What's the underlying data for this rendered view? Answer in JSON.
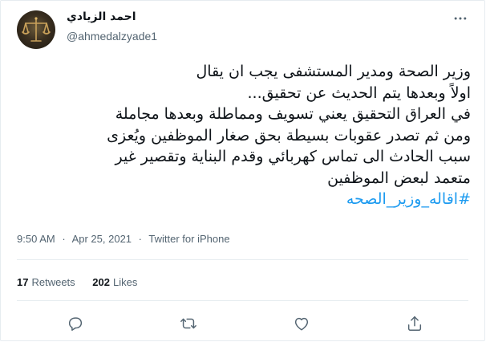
{
  "author": {
    "name": "احمد الزيادي",
    "handle": "@ahmedalzyade1",
    "avatar_icon": "scales-of-justice-icon"
  },
  "tweet": {
    "lines": [
      "وزير الصحة ومدير المستشفى يجب ان يقال",
      "اولاً وبعدها يتم الحديث عن تحقيق...",
      "في العراق التحقيق يعني تسويف ومماطلة وبعدها مجاملة",
      "ومن ثم تصدر عقوبات بسيطة بحق صغار الموظفين ويُعزى",
      "سبب الحادث الى تماس كهربائي وقدم البناية وتقصير غير",
      "متعمد لبعض الموظفين"
    ],
    "hashtag": "#اقاله_وزير_الصحه"
  },
  "meta": {
    "time": "9:50 AM",
    "separator": "·",
    "date": "Apr 25, 2021",
    "source": "Twitter for iPhone"
  },
  "stats": {
    "retweets_count": "17",
    "retweets_label": "Retweets",
    "likes_count": "202",
    "likes_label": "Likes"
  },
  "actions": [
    "reply-icon",
    "retweet-icon",
    "like-icon",
    "share-icon"
  ],
  "colors": {
    "text": "#0f1419",
    "muted": "#536471",
    "link": "#1d9bf0",
    "border": "#e6ecf0"
  }
}
